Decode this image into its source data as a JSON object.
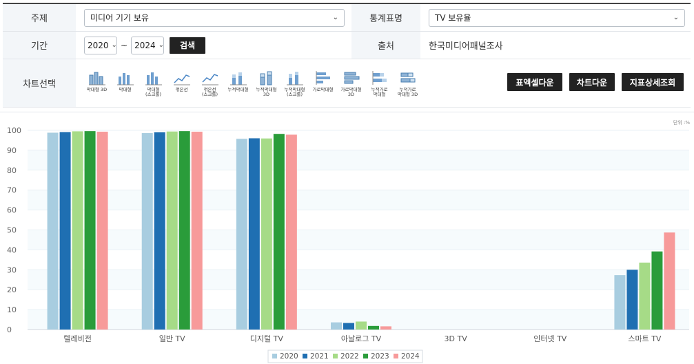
{
  "filters": {
    "subject_label": "주제",
    "subject_value": "미디어 기기 보유",
    "stat_label": "통계표명",
    "stat_value": "TV 보유율",
    "period_label": "기간",
    "start_year": "2020",
    "end_year": "2024",
    "tilde": "~",
    "search_button": "검색",
    "source_label": "출처",
    "source_value": "한국미디어패널조사",
    "chart_select_label": "차트선택"
  },
  "chart_types": [
    {
      "label": "막대형 3D",
      "icon": "bar-3d-icon"
    },
    {
      "label": "막대형",
      "icon": "bar-icon"
    },
    {
      "label": "막대형\n(스크롤)",
      "icon": "bar-scroll-icon"
    },
    {
      "label": "꺾은선",
      "icon": "line-icon"
    },
    {
      "label": "꺾은선\n(스크롤)",
      "icon": "line-scroll-icon"
    },
    {
      "label": "누적막대형",
      "icon": "stacked-bar-icon"
    },
    {
      "label": "누적막대형\n3D",
      "icon": "stacked-bar-3d-icon"
    },
    {
      "label": "누적막대형\n(스크롤)",
      "icon": "stacked-bar-scroll-icon"
    },
    {
      "label": "가로막대형",
      "icon": "horizontal-bar-icon"
    },
    {
      "label": "가로막대형\n3D",
      "icon": "horizontal-bar-3d-icon"
    },
    {
      "label": "누적가로\n막대형",
      "icon": "stacked-horizontal-bar-icon"
    },
    {
      "label": "누적가로\n막대형 3D",
      "icon": "stacked-horizontal-bar-3d-icon"
    }
  ],
  "actions": {
    "table_cell_download": "표엑셀다운",
    "chart_download": "차트다운",
    "indicator_detail": "지표상세조회"
  },
  "unit": "단위 :%",
  "colors": {
    "2020": "#a8cde0",
    "2021": "#1f6fb2",
    "2022": "#a6db87",
    "2023": "#2a9c3a",
    "2024": "#f79a9a",
    "grid": "#e9f1f6",
    "band": "#f6fbfd"
  },
  "chart_data": {
    "type": "bar",
    "categories": [
      "텔레비전",
      "일반 TV",
      "디지털 TV",
      "아날로그 TV",
      "3D TV",
      "인터넷 TV",
      "스마트 TV"
    ],
    "series": [
      {
        "name": "2020",
        "values": [
          98.8,
          98.6,
          95.7,
          3.6,
          0,
          0,
          27.3
        ]
      },
      {
        "name": "2021",
        "values": [
          99.1,
          99.0,
          96.0,
          3.3,
          0,
          0,
          30.0
        ]
      },
      {
        "name": "2022",
        "values": [
          99.5,
          99.4,
          95.9,
          4.0,
          0,
          0,
          33.6
        ]
      },
      {
        "name": "2023",
        "values": [
          99.6,
          99.6,
          98.2,
          1.8,
          0,
          0,
          39.2
        ]
      },
      {
        "name": "2024",
        "values": [
          99.3,
          99.3,
          97.8,
          1.6,
          0,
          0,
          48.7
        ]
      }
    ],
    "ylim": [
      0,
      100
    ],
    "yticks": [
      0,
      10,
      20,
      30,
      40,
      50,
      60,
      70,
      80,
      90,
      100
    ],
    "legend_position": "bottom-center"
  }
}
